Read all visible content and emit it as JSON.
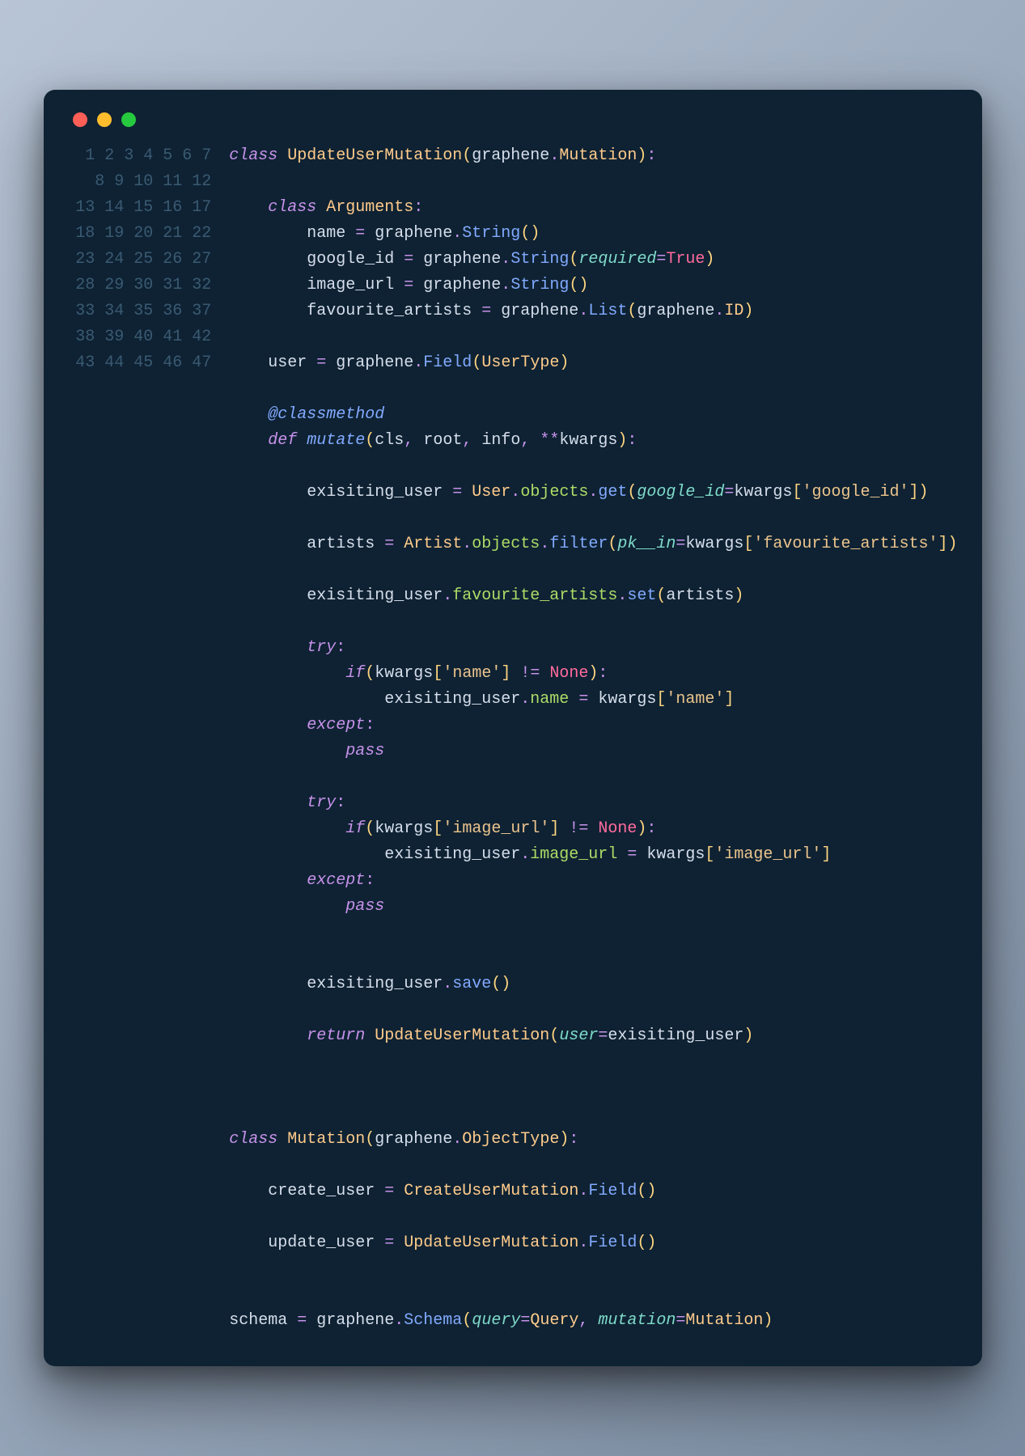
{
  "window": {
    "dots": [
      "red",
      "yellow",
      "green"
    ]
  },
  "line_count": 47,
  "lines": {
    "l1": {
      "indent": 0,
      "tokens": [
        [
          "kw",
          "class "
        ],
        [
          "cls",
          "UpdateUserMutation"
        ],
        [
          "paren",
          "("
        ],
        [
          "ident",
          "graphene"
        ],
        [
          "dot-tok",
          "."
        ],
        [
          "cls",
          "Mutation"
        ],
        [
          "paren",
          ")"
        ],
        [
          "punct",
          ":"
        ]
      ]
    },
    "l2": {
      "indent": 0,
      "tokens": []
    },
    "l3": {
      "indent": 1,
      "tokens": [
        [
          "kw",
          "class "
        ],
        [
          "cls",
          "Arguments"
        ],
        [
          "punct",
          ":"
        ]
      ]
    },
    "l4": {
      "indent": 2,
      "tokens": [
        [
          "ident",
          "name"
        ],
        [
          "op",
          " = "
        ],
        [
          "ident",
          "graphene"
        ],
        [
          "dot-tok",
          "."
        ],
        [
          "fn",
          "String"
        ],
        [
          "paren",
          "()"
        ]
      ]
    },
    "l5": {
      "indent": 2,
      "tokens": [
        [
          "ident",
          "google_id"
        ],
        [
          "op",
          " = "
        ],
        [
          "ident",
          "graphene"
        ],
        [
          "dot-tok",
          "."
        ],
        [
          "fn",
          "String"
        ],
        [
          "paren",
          "("
        ],
        [
          "kwarg",
          "required"
        ],
        [
          "op",
          "="
        ],
        [
          "const",
          "True"
        ],
        [
          "paren",
          ")"
        ]
      ]
    },
    "l6": {
      "indent": 2,
      "tokens": [
        [
          "ident",
          "image_url"
        ],
        [
          "op",
          " = "
        ],
        [
          "ident",
          "graphene"
        ],
        [
          "dot-tok",
          "."
        ],
        [
          "fn",
          "String"
        ],
        [
          "paren",
          "()"
        ]
      ]
    },
    "l7": {
      "indent": 2,
      "tokens": [
        [
          "ident",
          "favourite_artists"
        ],
        [
          "op",
          " = "
        ],
        [
          "ident",
          "graphene"
        ],
        [
          "dot-tok",
          "."
        ],
        [
          "fn",
          "List"
        ],
        [
          "paren",
          "("
        ],
        [
          "ident",
          "graphene"
        ],
        [
          "dot-tok",
          "."
        ],
        [
          "cls",
          "ID"
        ],
        [
          "paren",
          ")"
        ]
      ]
    },
    "l8": {
      "indent": 0,
      "tokens": []
    },
    "l9": {
      "indent": 1,
      "tokens": [
        [
          "ident",
          "user"
        ],
        [
          "op",
          " = "
        ],
        [
          "ident",
          "graphene"
        ],
        [
          "dot-tok",
          "."
        ],
        [
          "fn",
          "Field"
        ],
        [
          "paren",
          "("
        ],
        [
          "cls",
          "UserType"
        ],
        [
          "paren",
          ")"
        ]
      ]
    },
    "l10": {
      "indent": 0,
      "tokens": []
    },
    "l11": {
      "indent": 1,
      "tokens": [
        [
          "deco",
          "@classmethod"
        ]
      ]
    },
    "l12": {
      "indent": 1,
      "tokens": [
        [
          "kw",
          "def "
        ],
        [
          "fn-i",
          "mutate"
        ],
        [
          "paren",
          "("
        ],
        [
          "ident",
          "cls"
        ],
        [
          "punct",
          ", "
        ],
        [
          "ident",
          "root"
        ],
        [
          "punct",
          ", "
        ],
        [
          "ident",
          "info"
        ],
        [
          "punct",
          ", "
        ],
        [
          "op",
          "**"
        ],
        [
          "ident",
          "kwargs"
        ],
        [
          "paren",
          ")"
        ],
        [
          "punct",
          ":"
        ]
      ]
    },
    "l13": {
      "indent": 0,
      "tokens": []
    },
    "l14": {
      "indent": 2,
      "tokens": [
        [
          "ident",
          "exisiting_user"
        ],
        [
          "op",
          " = "
        ],
        [
          "cls",
          "User"
        ],
        [
          "dot-tok",
          "."
        ],
        [
          "attr",
          "objects"
        ],
        [
          "dot-tok",
          "."
        ],
        [
          "fn",
          "get"
        ],
        [
          "paren",
          "("
        ],
        [
          "kwarg",
          "google_id"
        ],
        [
          "op",
          "="
        ],
        [
          "ident",
          "kwargs"
        ],
        [
          "brack",
          "["
        ],
        [
          "str",
          "'google_id'"
        ],
        [
          "brack",
          "]"
        ],
        [
          "paren",
          ")"
        ]
      ]
    },
    "l15": {
      "indent": 0,
      "tokens": []
    },
    "l16": {
      "indent": 2,
      "tokens": [
        [
          "ident",
          "artists"
        ],
        [
          "op",
          " = "
        ],
        [
          "cls",
          "Artist"
        ],
        [
          "dot-tok",
          "."
        ],
        [
          "attr",
          "objects"
        ],
        [
          "dot-tok",
          "."
        ],
        [
          "fn",
          "filter"
        ],
        [
          "paren",
          "("
        ],
        [
          "kwarg",
          "pk__in"
        ],
        [
          "op",
          "="
        ],
        [
          "ident",
          "kwargs"
        ],
        [
          "brack",
          "["
        ],
        [
          "str",
          "'favourite_artists'"
        ],
        [
          "brack",
          "]"
        ],
        [
          "paren",
          ")"
        ]
      ]
    },
    "l17": {
      "indent": 0,
      "tokens": []
    },
    "l18": {
      "indent": 2,
      "tokens": [
        [
          "ident",
          "exisiting_user"
        ],
        [
          "dot-tok",
          "."
        ],
        [
          "attr",
          "favourite_artists"
        ],
        [
          "dot-tok",
          "."
        ],
        [
          "fn",
          "set"
        ],
        [
          "paren",
          "("
        ],
        [
          "ident",
          "artists"
        ],
        [
          "paren",
          ")"
        ]
      ]
    },
    "l19": {
      "indent": 0,
      "tokens": []
    },
    "l20": {
      "indent": 2,
      "tokens": [
        [
          "kw",
          "try"
        ],
        [
          "punct",
          ":"
        ]
      ]
    },
    "l21": {
      "indent": 3,
      "tokens": [
        [
          "kw",
          "if"
        ],
        [
          "paren",
          "("
        ],
        [
          "ident",
          "kwargs"
        ],
        [
          "brack",
          "["
        ],
        [
          "str",
          "'name'"
        ],
        [
          "brack",
          "]"
        ],
        [
          "op",
          " != "
        ],
        [
          "const",
          "None"
        ],
        [
          "paren",
          ")"
        ],
        [
          "punct",
          ":"
        ]
      ]
    },
    "l22": {
      "indent": 4,
      "tokens": [
        [
          "ident",
          "exisiting_user"
        ],
        [
          "dot-tok",
          "."
        ],
        [
          "attr",
          "name"
        ],
        [
          "op",
          " = "
        ],
        [
          "ident",
          "kwargs"
        ],
        [
          "brack",
          "["
        ],
        [
          "str",
          "'name'"
        ],
        [
          "brack",
          "]"
        ]
      ]
    },
    "l23": {
      "indent": 2,
      "tokens": [
        [
          "kw",
          "except"
        ],
        [
          "punct",
          ":"
        ]
      ]
    },
    "l24": {
      "indent": 3,
      "tokens": [
        [
          "kw",
          "pass"
        ]
      ]
    },
    "l25": {
      "indent": 0,
      "tokens": []
    },
    "l26": {
      "indent": 2,
      "tokens": [
        [
          "kw",
          "try"
        ],
        [
          "punct",
          ":"
        ]
      ]
    },
    "l27": {
      "indent": 3,
      "tokens": [
        [
          "kw",
          "if"
        ],
        [
          "paren",
          "("
        ],
        [
          "ident",
          "kwargs"
        ],
        [
          "brack",
          "["
        ],
        [
          "str",
          "'image_url'"
        ],
        [
          "brack",
          "]"
        ],
        [
          "op",
          " != "
        ],
        [
          "const",
          "None"
        ],
        [
          "paren",
          ")"
        ],
        [
          "punct",
          ":"
        ]
      ]
    },
    "l28": {
      "indent": 4,
      "tokens": [
        [
          "ident",
          "exisiting_user"
        ],
        [
          "dot-tok",
          "."
        ],
        [
          "attr",
          "image_url"
        ],
        [
          "op",
          " = "
        ],
        [
          "ident",
          "kwargs"
        ],
        [
          "brack",
          "["
        ],
        [
          "str",
          "'image_url'"
        ],
        [
          "brack",
          "]"
        ]
      ]
    },
    "l29": {
      "indent": 2,
      "tokens": [
        [
          "kw",
          "except"
        ],
        [
          "punct",
          ":"
        ]
      ]
    },
    "l30": {
      "indent": 3,
      "tokens": [
        [
          "kw",
          "pass"
        ]
      ]
    },
    "l31": {
      "indent": 0,
      "tokens": []
    },
    "l32": {
      "indent": 0,
      "tokens": []
    },
    "l33": {
      "indent": 2,
      "tokens": [
        [
          "ident",
          "exisiting_user"
        ],
        [
          "dot-tok",
          "."
        ],
        [
          "fn",
          "save"
        ],
        [
          "paren",
          "()"
        ]
      ]
    },
    "l34": {
      "indent": 0,
      "tokens": []
    },
    "l35": {
      "indent": 2,
      "tokens": [
        [
          "kw",
          "return "
        ],
        [
          "cls",
          "UpdateUserMutation"
        ],
        [
          "paren",
          "("
        ],
        [
          "kwarg",
          "user"
        ],
        [
          "op",
          "="
        ],
        [
          "ident",
          "exisiting_user"
        ],
        [
          "paren",
          ")"
        ]
      ]
    },
    "l36": {
      "indent": 0,
      "tokens": []
    },
    "l37": {
      "indent": 0,
      "tokens": []
    },
    "l38": {
      "indent": 0,
      "tokens": []
    },
    "l39": {
      "indent": 0,
      "tokens": [
        [
          "kw",
          "class "
        ],
        [
          "cls",
          "Mutation"
        ],
        [
          "paren",
          "("
        ],
        [
          "ident",
          "graphene"
        ],
        [
          "dot-tok",
          "."
        ],
        [
          "cls",
          "ObjectType"
        ],
        [
          "paren",
          ")"
        ],
        [
          "punct",
          ":"
        ]
      ]
    },
    "l40": {
      "indent": 0,
      "tokens": []
    },
    "l41": {
      "indent": 1,
      "tokens": [
        [
          "ident",
          "create_user"
        ],
        [
          "op",
          " = "
        ],
        [
          "cls",
          "CreateUserMutation"
        ],
        [
          "dot-tok",
          "."
        ],
        [
          "fn",
          "Field"
        ],
        [
          "paren",
          "()"
        ]
      ]
    },
    "l42": {
      "indent": 0,
      "tokens": []
    },
    "l43": {
      "indent": 1,
      "tokens": [
        [
          "ident",
          "update_user"
        ],
        [
          "op",
          " = "
        ],
        [
          "cls",
          "UpdateUserMutation"
        ],
        [
          "dot-tok",
          "."
        ],
        [
          "fn",
          "Field"
        ],
        [
          "paren",
          "()"
        ]
      ]
    },
    "l44": {
      "indent": 0,
      "tokens": []
    },
    "l45": {
      "indent": 0,
      "tokens": []
    },
    "l46": {
      "indent": 0,
      "tokens": [
        [
          "ident",
          "schema"
        ],
        [
          "op",
          " = "
        ],
        [
          "ident",
          "graphene"
        ],
        [
          "dot-tok",
          "."
        ],
        [
          "fn",
          "Schema"
        ],
        [
          "paren",
          "("
        ],
        [
          "kwarg",
          "query"
        ],
        [
          "op",
          "="
        ],
        [
          "cls",
          "Query"
        ],
        [
          "punct",
          ", "
        ],
        [
          "kwarg",
          "mutation"
        ],
        [
          "op",
          "="
        ],
        [
          "cls",
          "Mutation"
        ],
        [
          "paren",
          ")"
        ]
      ]
    },
    "l47": {
      "indent": 0,
      "tokens": []
    }
  }
}
